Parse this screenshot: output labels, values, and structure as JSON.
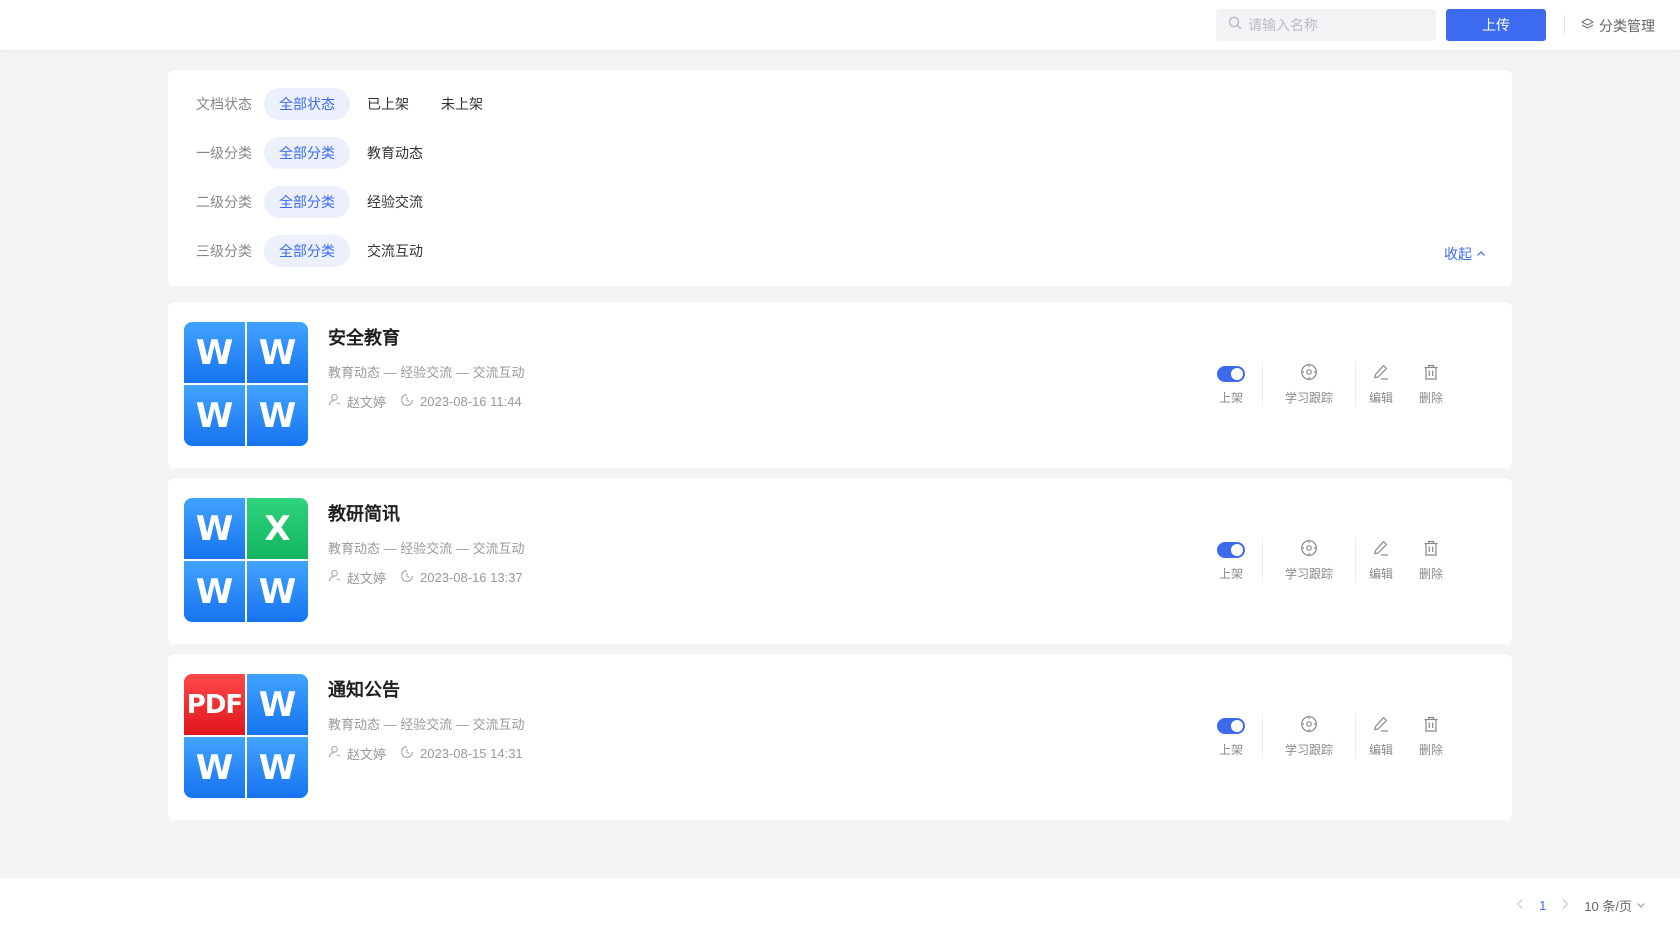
{
  "header": {
    "search_placeholder": "请输入名称",
    "upload_label": "上传",
    "category_manage_label": "分类管理"
  },
  "filters": {
    "rows": [
      {
        "label": "文档状态",
        "options": [
          "全部状态",
          "已上架",
          "未上架"
        ],
        "selected": "全部状态"
      },
      {
        "label": "一级分类",
        "options": [
          "全部分类",
          "教育动态"
        ],
        "selected": "全部分类"
      },
      {
        "label": "二级分类",
        "options": [
          "全部分类",
          "经验交流"
        ],
        "selected": "全部分类"
      },
      {
        "label": "三级分类",
        "options": [
          "全部分类",
          "交流互动"
        ],
        "selected": "全部分类"
      }
    ],
    "collapse_label": "收起"
  },
  "documents": [
    {
      "title": "安全教育",
      "path": "教育动态 — 经验交流 — 交流互动",
      "author": "赵文婷",
      "time": "2023-08-16 11:44",
      "thumb_tiles": [
        "W",
        "W",
        "W",
        "W"
      ],
      "published": true
    },
    {
      "title": "教研简讯",
      "path": "教育动态 — 经验交流 — 交流互动",
      "author": "赵文婷",
      "time": "2023-08-16 13:37",
      "thumb_tiles": [
        "W",
        "X",
        "W",
        "W"
      ],
      "published": true
    },
    {
      "title": "通知公告",
      "path": "教育动态 — 经验交流 — 交流互动",
      "author": "赵文婷",
      "time": "2023-08-15 14:31",
      "thumb_tiles": [
        "PDF",
        "W",
        "W",
        "W"
      ],
      "published": true
    }
  ],
  "actions": {
    "shelf_label": "上架",
    "track_label": "学习跟踪",
    "edit_label": "编辑",
    "delete_label": "删除"
  },
  "pagination": {
    "current_page": "1",
    "page_size_label": "10 条/页"
  },
  "colors": {
    "accent": "#3d6bf0",
    "word_blue": "#1673f0",
    "excel_green": "#12b45f",
    "pdf_red": "#e0151d",
    "page_bg": "#f2f3f5"
  }
}
